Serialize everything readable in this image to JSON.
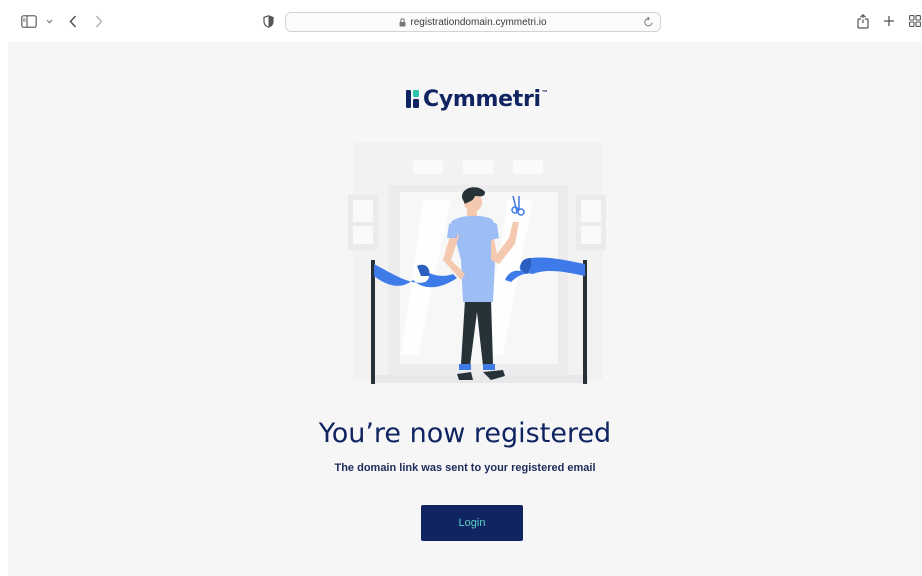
{
  "browser": {
    "url": "registrationdomain.cymmetri.io"
  },
  "page": {
    "logo_text": "Cymmetri",
    "logo_tm": "™",
    "headline": "You’re now registered",
    "subline": "The domain link was sent to your registered email",
    "login_label": "Login"
  },
  "colors": {
    "brand_navy": "#0f2461",
    "button_text": "#5fd2c6",
    "ribbon": "#3f7be8"
  }
}
